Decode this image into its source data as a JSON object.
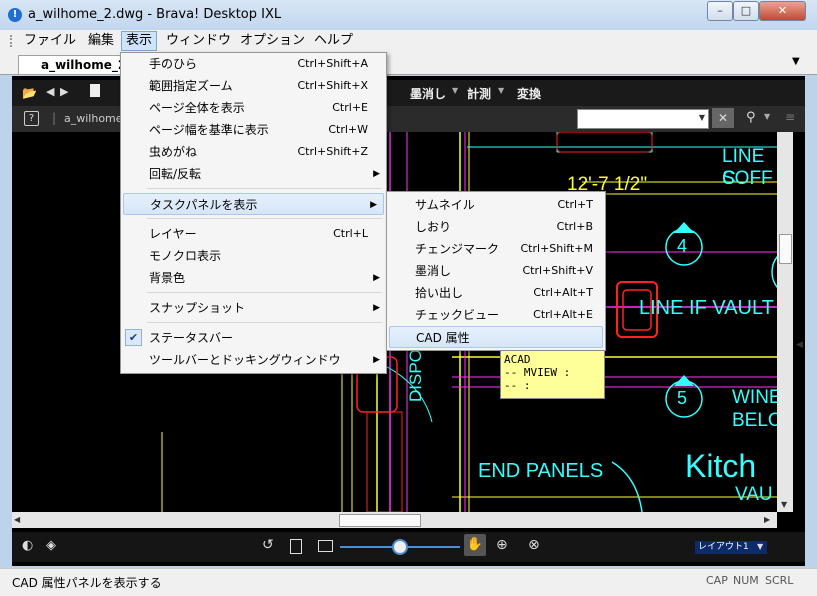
{
  "window": {
    "title": "a_wilhome_2.dwg - Brava! Desktop IXL"
  },
  "menubar": {
    "items": [
      "ファイル",
      "編集",
      "表示",
      "ウィンドウ",
      "オプション",
      "ヘルプ"
    ],
    "active": "表示"
  },
  "tab": {
    "label": "a_wilhome_2.d"
  },
  "toolbar": {
    "visible_labels": [
      "墨消し",
      "計測",
      "変換"
    ]
  },
  "subtoolbar": {
    "doc_label": "a_wilhome_"
  },
  "view_menu": {
    "items": [
      {
        "label": "手のひら",
        "shortcut": "Ctrl+Shift+A"
      },
      {
        "label": "範囲指定ズーム",
        "shortcut": "Ctrl+Shift+X"
      },
      {
        "label": "ページ全体を表示",
        "shortcut": "Ctrl+E"
      },
      {
        "label": "ページ幅を基準に表示",
        "shortcut": "Ctrl+W"
      },
      {
        "label": "虫めがね",
        "shortcut": "Ctrl+Shift+Z"
      },
      {
        "label": "回転/反転",
        "shortcut": ""
      },
      {
        "label": "タスクパネルを表示",
        "shortcut": ""
      },
      {
        "label": "レイヤー",
        "shortcut": "Ctrl+L"
      },
      {
        "label": "モノクロ表示",
        "shortcut": ""
      },
      {
        "label": "背景色",
        "shortcut": ""
      },
      {
        "label": "スナップショット",
        "shortcut": ""
      },
      {
        "label": "ステータスバー",
        "shortcut": ""
      },
      {
        "label": "ツールバーとドッキングウィンドウ",
        "shortcut": ""
      }
    ]
  },
  "task_submenu": {
    "items": [
      {
        "label": "サムネイル",
        "shortcut": "Ctrl+T"
      },
      {
        "label": "しおり",
        "shortcut": "Ctrl+B"
      },
      {
        "label": "チェンジマーク",
        "shortcut": "Ctrl+Shift+M"
      },
      {
        "label": "墨消し",
        "shortcut": "Ctrl+Shift+V"
      },
      {
        "label": "拾い出し",
        "shortcut": "Ctrl+Alt+T"
      },
      {
        "label": "チェックビュー",
        "shortcut": "Ctrl+Alt+E"
      },
      {
        "label": "CAD 属性",
        "shortcut": ""
      }
    ]
  },
  "tooltip": {
    "line1": "ACAD",
    "line2": "--  MVIEW :",
    "line3": "--    :"
  },
  "drawing": {
    "dim": "12'-7 1/2\"",
    "line_c": "LINE C",
    "soff": "SOFF",
    "vault": "LINE IF VAULT",
    "disposal": "DISPOSAL",
    "end_panels": "END PANELS",
    "kitch": "Kitch",
    "vau": "VAU",
    "wine": "WINE",
    "belo": "BELO",
    "num4": "4",
    "num5": "5"
  },
  "bottombar": {
    "layout": "レイアウト1"
  },
  "status": {
    "text": "CAD 属性パネルを表示する",
    "indicators": [
      "CAP",
      "NUM",
      "SCRL"
    ]
  }
}
